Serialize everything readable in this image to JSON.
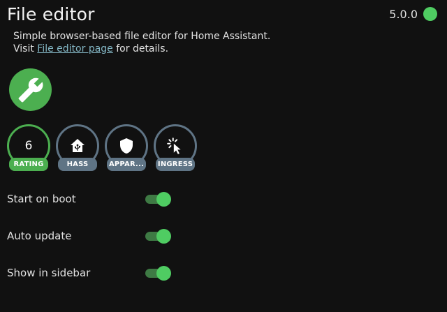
{
  "header": {
    "title": "File editor",
    "version": "5.0.0",
    "status_color": "#4fcc62"
  },
  "description": {
    "line1": "Simple browser-based file editor for Home Assistant.",
    "line2_prefix": "Visit ",
    "link_text": "File editor page",
    "line2_suffix": " for details."
  },
  "logo": {
    "icon": "wrench-icon",
    "color": "#4caf50"
  },
  "badges": [
    {
      "value": "6",
      "label": "RATING",
      "icon": null,
      "color": "#4caf50"
    },
    {
      "value": null,
      "label": "HASS",
      "icon": "home-assistant-icon",
      "color": "#5f7485"
    },
    {
      "value": null,
      "label": "APPAR...",
      "icon": "shield-icon",
      "color": "#5f7485"
    },
    {
      "value": null,
      "label": "INGRESS",
      "icon": "cursor-click-icon",
      "color": "#5f7485"
    }
  ],
  "settings": [
    {
      "label": "Start on boot",
      "enabled": true
    },
    {
      "label": "Auto update",
      "enabled": true
    },
    {
      "label": "Show in sidebar",
      "enabled": true
    }
  ]
}
